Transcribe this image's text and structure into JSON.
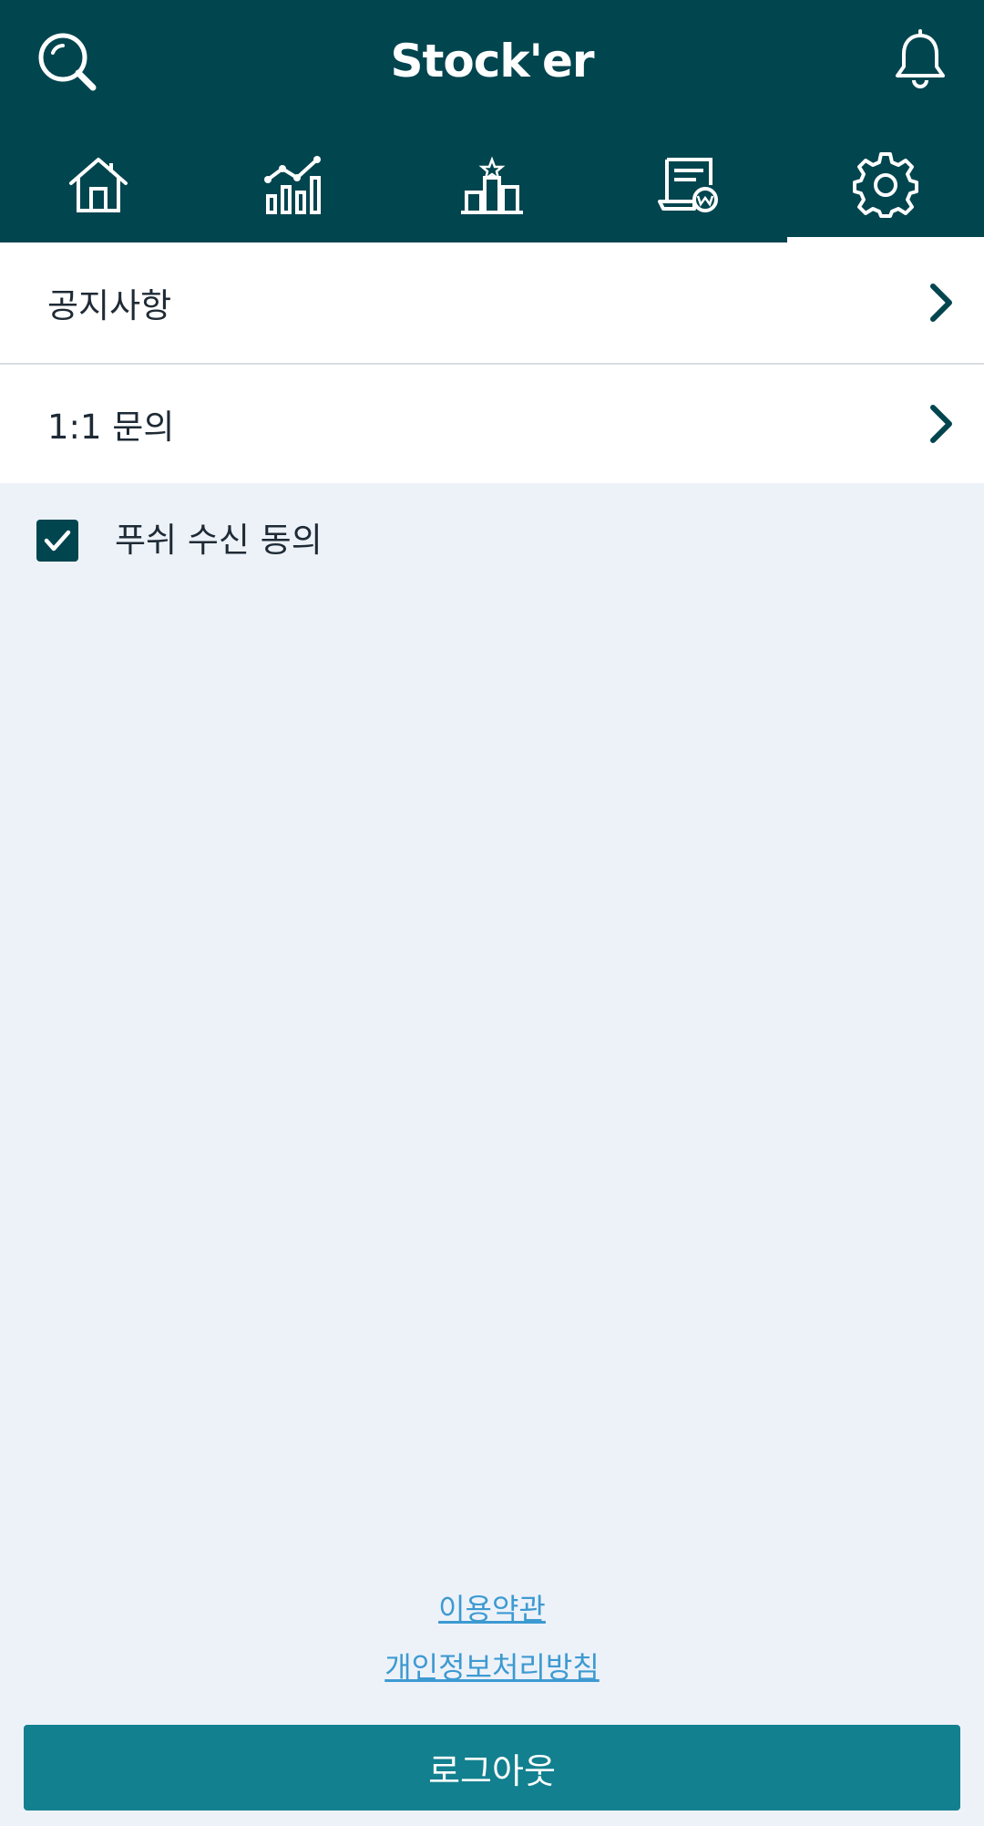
{
  "header": {
    "title": "Stock'er",
    "left_icon": "search-icon",
    "right_icon": "bell-icon"
  },
  "tabs": [
    {
      "icon": "home-icon",
      "active": false
    },
    {
      "icon": "chart-icon",
      "active": false
    },
    {
      "icon": "ranking-icon",
      "active": false
    },
    {
      "icon": "receipt-icon",
      "active": false
    },
    {
      "icon": "gear-icon",
      "active": true
    }
  ],
  "menu": {
    "items": [
      {
        "label": "공지사항"
      },
      {
        "label": "1:1 문의"
      }
    ]
  },
  "push": {
    "label": "푸쉬 수신 동의",
    "checked": true
  },
  "footer": {
    "terms": "이용약관",
    "privacy": "개인정보처리방침",
    "logout": "로그아웃"
  },
  "colors": {
    "header_bg": "#01454f",
    "page_bg": "#edf2f9",
    "link": "#3d9ad1",
    "logout_bg": "#12808f"
  }
}
